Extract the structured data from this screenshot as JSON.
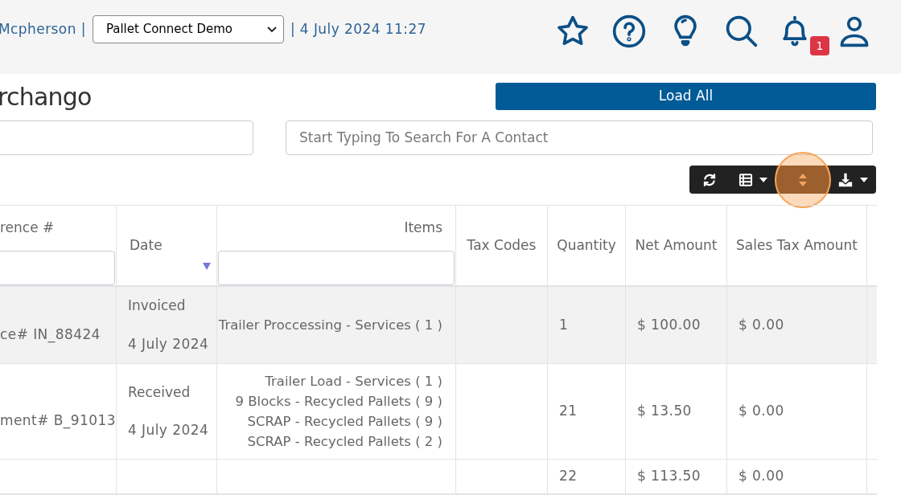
{
  "header": {
    "user_text": "Mcpherson |",
    "company_select": {
      "value": "Pallet Connect Demo"
    },
    "datetime": "| 4 July 2024 11:27",
    "notifications_badge": "1"
  },
  "page_title": "rchango",
  "load_all_button": "Load All",
  "contact_search": {
    "placeholder": "Start Typing To Search For A Contact"
  },
  "toolbar": [
    {
      "kind": "refresh",
      "caret": false,
      "highlighted": false
    },
    {
      "kind": "columns",
      "caret": true,
      "highlighted": false
    },
    {
      "kind": "sort",
      "caret": false,
      "highlighted": true
    },
    {
      "kind": "download",
      "caret": true,
      "highlighted": false
    }
  ],
  "table": {
    "columns": [
      {
        "label": "rence #",
        "filter": true,
        "sorted": false
      },
      {
        "label": "Date",
        "filter": false,
        "sorted": true
      },
      {
        "label": "Items",
        "filter": true,
        "sorted": false
      },
      {
        "label": "Tax Codes",
        "filter": false,
        "sorted": false
      },
      {
        "label": "Quantity",
        "filter": false,
        "sorted": false
      },
      {
        "label": "Net Amount",
        "filter": false,
        "sorted": false
      },
      {
        "label": "Sales Tax Amount",
        "filter": false,
        "sorted": false
      }
    ],
    "rows": [
      {
        "highlighted": true,
        "reference": "ce# IN_88424",
        "status": "Invoiced",
        "date": "4 July 2024",
        "items": [
          "Trailer Proccessing - Services ( 1 )"
        ],
        "quantity": "1",
        "net_amount": "$ 100.00",
        "sales_tax_amount": "$ 0.00"
      },
      {
        "highlighted": false,
        "reference": "ment# B_91013",
        "status": "Received",
        "date": "4 July 2024",
        "items": [
          "Trailer Load - Services ( 1 )",
          "9 Blocks - Recycled Pallets ( 9 )",
          "SCRAP - Recycled Pallets ( 9 )",
          "SCRAP - Recycled Pallets ( 2 )"
        ],
        "quantity": "21",
        "net_amount": "$ 13.50",
        "sales_tax_amount": "$ 0.00"
      }
    ],
    "totals": {
      "quantity": "22",
      "net_amount": "$ 113.50",
      "sales_tax_amount": "$ 0.00"
    }
  }
}
